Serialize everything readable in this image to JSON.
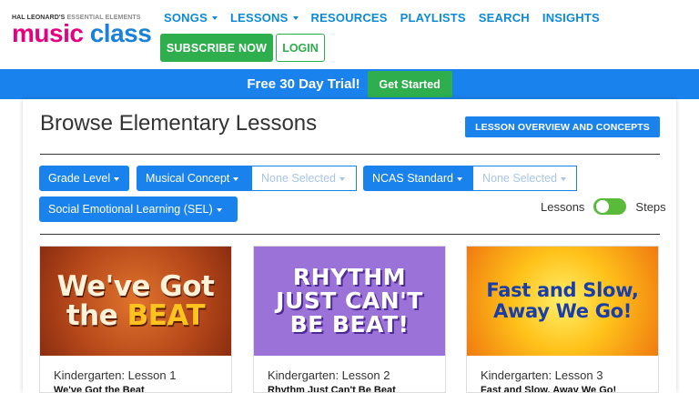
{
  "header": {
    "logo_top_a": "HAL LEONARD'S",
    "logo_top_b": "ESSENTIAL ELEMENTS",
    "logo_music": "music",
    "logo_class": "class",
    "nav": [
      {
        "label": "SONGS",
        "dropdown": true
      },
      {
        "label": "LESSONS",
        "dropdown": true
      },
      {
        "label": "RESOURCES",
        "dropdown": false
      },
      {
        "label": "PLAYLISTS",
        "dropdown": false
      },
      {
        "label": "SEARCH",
        "dropdown": false
      },
      {
        "label": "INSIGHTS",
        "dropdown": false
      }
    ],
    "subscribe_label": "SUBSCRIBE NOW",
    "login_label": "LOGIN"
  },
  "banner": {
    "text": "Free 30 Day Trial!",
    "button_label": "Get Started"
  },
  "main": {
    "title": "Browse Elementary Lessons",
    "overview_button": "LESSON OVERVIEW AND CONCEPTS",
    "filters": {
      "grade_level": "Grade Level",
      "musical_concept": "Musical Concept",
      "musical_concept_value": "None Selected",
      "ncas_standard": "NCAS Standard",
      "ncas_value": "None Selected",
      "sel": "Social Emotional Learning (SEL)"
    },
    "toggle": {
      "left_label": "Lessons",
      "right_label": "Steps"
    },
    "cards": [
      {
        "image_line1": "We've Got",
        "image_line2a": "the ",
        "image_line2b": "BEAT",
        "meta": "Kindergarten: Lesson 1",
        "name": "We've Got the Beat"
      },
      {
        "image_line1": "RHYTHM",
        "image_line2": "JUST CAN'T",
        "image_line3": "BE BEAT!",
        "meta": "Kindergarten: Lesson 2",
        "name": "Rhythm Just Can't Be Beat"
      },
      {
        "image_line1": "Fast and Slow,",
        "image_line2": "Away We Go!",
        "meta": "Kindergarten: Lesson 3",
        "name": "Fast and Slow, Away We Go!"
      }
    ]
  },
  "colors": {
    "brand_blue": "#1a82ec",
    "nav_blue": "#0d8ad6",
    "green": "#2eae4d",
    "magenta": "#e6007e"
  }
}
